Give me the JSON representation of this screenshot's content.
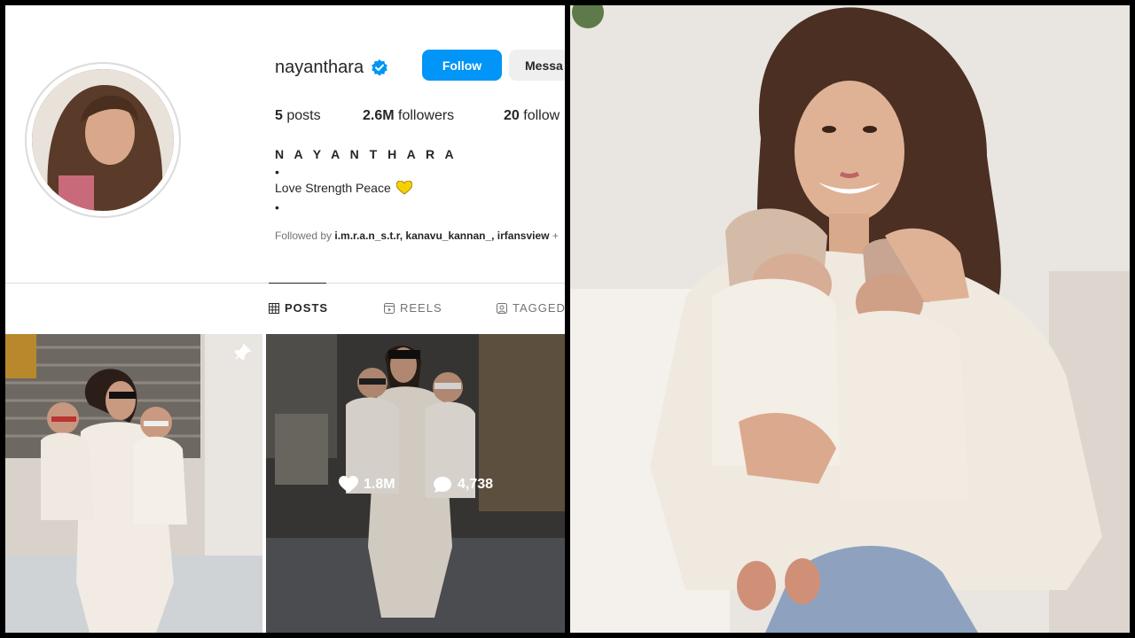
{
  "profile": {
    "username": "nayanthara",
    "follow_label": "Follow",
    "message_label": "Messa",
    "stats": {
      "posts_num": "5",
      "posts_label": "posts",
      "followers_num": "2.6M",
      "followers_label": "followers",
      "following_num": "20",
      "following_label": "follow"
    },
    "full_name": "N A Y A N T H A R A",
    "bio_dot": "•",
    "bio_text": "Love Strength Peace",
    "followed_by_prefix": "Followed by",
    "followed_by_names": "i.m.r.a.n_s.t.r, kanavu_kannan_, irfansview",
    "followed_by_suffix": "+"
  },
  "tabs": [
    {
      "label": "POSTS",
      "icon": "grid-icon"
    },
    {
      "label": "REELS",
      "icon": "reels-icon"
    },
    {
      "label": "TAGGED",
      "icon": "tagged-icon"
    }
  ],
  "posts": [
    {
      "pinned": true
    },
    {
      "likes": "1.8M",
      "comments": "4,738"
    }
  ],
  "colors": {
    "follow_blue": "#0095f6",
    "verified_blue": "#0095f6",
    "text": "#262626",
    "muted": "#737373"
  }
}
